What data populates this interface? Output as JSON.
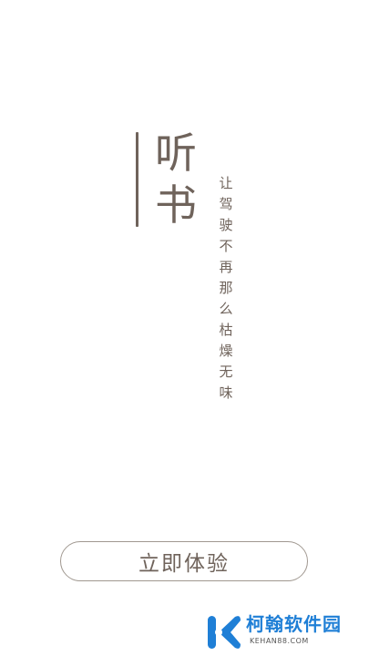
{
  "splash": {
    "title_line1": "听",
    "title_line2": "书",
    "tagline": "让驾驶不再那么枯燥无味",
    "cta_label": "立即体验"
  },
  "watermark": {
    "name": "柯翰软件园",
    "domain": "KEHAN88.COM",
    "logo_icon": "k-logo-icon"
  },
  "colors": {
    "accent": "#6f635b",
    "button_border": "#a09890",
    "background": "#ffffff",
    "watermark_blue": "#1f7fd6"
  }
}
